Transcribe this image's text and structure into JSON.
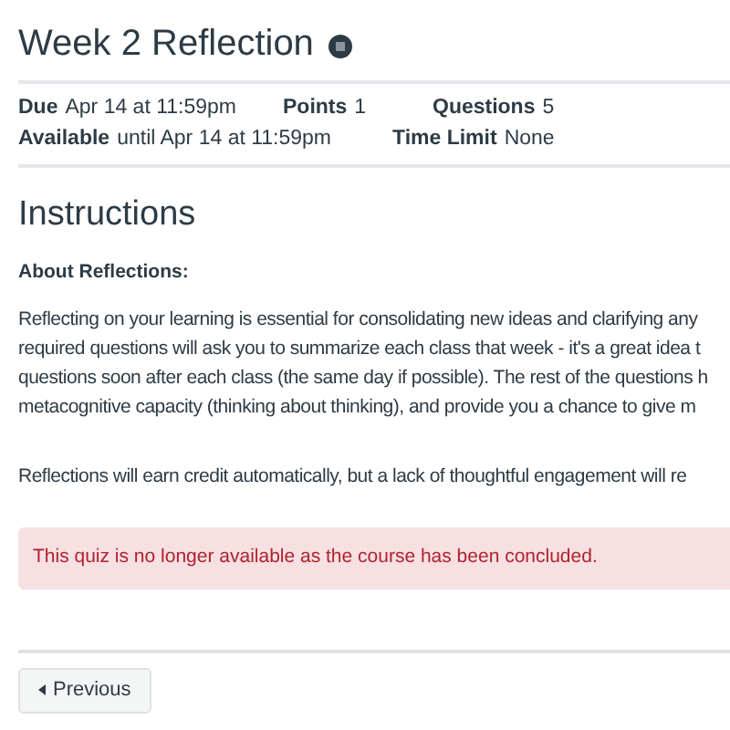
{
  "title": "Week 2 Reflection",
  "details": [
    {
      "label": "Due",
      "value": "Apr 14 at 11:59pm"
    },
    {
      "label": "Points",
      "value": "1"
    },
    {
      "label": "Questions",
      "value": "5"
    },
    {
      "label": "Available",
      "value": "until Apr 14 at 11:59pm"
    },
    {
      "label": "Time Limit",
      "value": "None"
    }
  ],
  "instructions": {
    "heading": "Instructions",
    "subheading": "About Reflections:",
    "paragraph_lines": [
      "Reflecting on your learning is essential for consolidating new ideas and clarifying any",
      "required questions will ask you to summarize each class that week - it's a great idea t",
      "questions soon after each class (the same day if possible). The rest of the questions h",
      "metacognitive capacity (thinking about thinking), and provide you a chance to give m"
    ],
    "second_paragraph": "Reflections will earn credit automatically, but a lack of thoughtful engagement will re"
  },
  "alert": "This quiz is no longer available as the course has been concluded.",
  "previous_button": "Previous"
}
